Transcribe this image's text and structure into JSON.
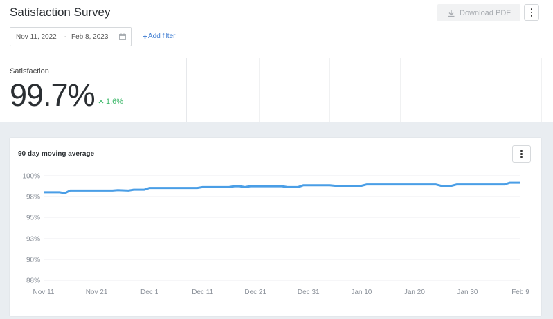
{
  "header": {
    "title": "Satisfaction Survey",
    "download_label": "Download PDF",
    "date_start": "Nov 11, 2022",
    "date_separator": "-",
    "date_end": "Feb 8, 2023",
    "add_filter_label": "Add filter"
  },
  "kpi": {
    "label": "Satisfaction",
    "value": "99.7%",
    "delta": "1.6%",
    "delta_color": "#3fb86b"
  },
  "card": {
    "title": "90 day moving average"
  },
  "chart_data": {
    "type": "line",
    "title": "90 day moving average",
    "xlabel": "",
    "ylabel": "",
    "ylim": [
      88,
      100
    ],
    "yticks": [
      "100%",
      "98%",
      "95%",
      "93%",
      "90%",
      "88%"
    ],
    "xticks": [
      "Nov 11",
      "Nov 21",
      "Dec 1",
      "Dec 11",
      "Dec 21",
      "Dec 31",
      "Jan 10",
      "Jan 20",
      "Jan 30",
      "Feb 9"
    ],
    "grid": true,
    "line_color": "#4a9ee6",
    "series": [
      {
        "x": [
          "Nov 11",
          "Nov 14",
          "Nov 15",
          "Nov 16",
          "Nov 24",
          "Nov 25",
          "Nov 27",
          "Nov 28",
          "Nov 30",
          "Dec 1",
          "Dec 10",
          "Dec 11",
          "Dec 16",
          "Dec 17",
          "Dec 18",
          "Dec 19",
          "Dec 20",
          "Dec 26",
          "Dec 27",
          "Dec 29",
          "Dec 30",
          "Jan 4",
          "Jan 5",
          "Jan 10",
          "Jan 11",
          "Jan 24",
          "Jan 25",
          "Jan 27",
          "Jan 28",
          "Feb 6",
          "Feb 7",
          "Feb 9"
        ],
        "values": [
          98.1,
          98.1,
          98.0,
          98.3,
          98.3,
          98.35,
          98.3,
          98.4,
          98.4,
          98.6,
          98.6,
          98.7,
          98.7,
          98.8,
          98.8,
          98.7,
          98.8,
          98.8,
          98.7,
          98.7,
          98.9,
          98.9,
          98.85,
          98.85,
          99.0,
          99.0,
          98.85,
          98.85,
          99.0,
          99.0,
          99.2,
          99.2
        ]
      }
    ]
  }
}
